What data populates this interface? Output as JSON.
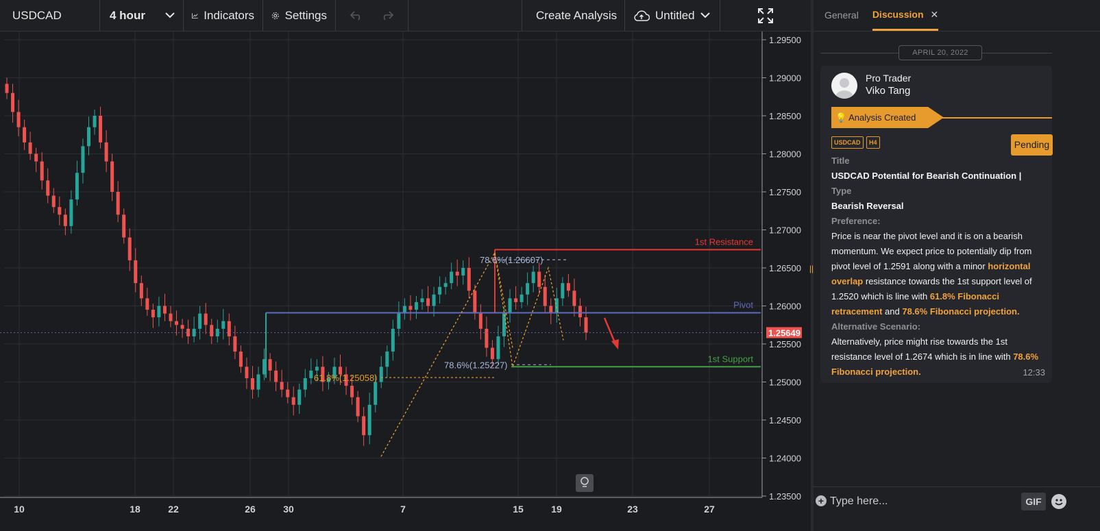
{
  "toolbar": {
    "symbol": "USDCAD",
    "interval": "4 hour",
    "indicators": "Indicators",
    "settings": "Settings",
    "create_analysis": "Create Analysis",
    "layout_name": "Untitled"
  },
  "chart": {
    "price_ticks": [
      "1.29500",
      "1.29000",
      "1.28500",
      "1.28000",
      "1.27500",
      "1.27000",
      "1.26500",
      "1.26000",
      "1.25500",
      "1.25000",
      "1.24500",
      "1.24000",
      "1.23500"
    ],
    "date_ticks": [
      "10",
      "18",
      "22",
      "26",
      "30",
      "7",
      "15",
      "19",
      "23",
      "27"
    ],
    "current_price": "1.25649",
    "levels": {
      "resistance": "1st Resistance",
      "pivot": "Pivot",
      "support": "1st Support"
    },
    "fib_labels": {
      "fib_top": "78.6%(1.26607)",
      "fib_mid": "78.6%(1.25227)",
      "fib_left": "61.8%(1.25058)"
    },
    "colors": {
      "bull": "#26a69a",
      "bear": "#ef5350",
      "resistance": "#e53935",
      "pivot": "#5c6bc0",
      "support": "#43a047",
      "fib": "#e69b2c",
      "price_tag": "#ef5350"
    }
  },
  "chart_data": {
    "type": "candlestick",
    "symbol": "USDCAD",
    "timeframe": "H4",
    "ylim": [
      1.235,
      1.295
    ],
    "current_price": 1.25649,
    "levels": [
      {
        "name": "1st Resistance",
        "value": 1.2674
      },
      {
        "name": "Pivot",
        "value": 1.2591
      },
      {
        "name": "1st Support",
        "value": 1.252
      }
    ],
    "fibonacci": [
      {
        "label": "78.6%",
        "value": 1.26607
      },
      {
        "label": "78.6%",
        "value": 1.25227
      },
      {
        "label": "61.8%",
        "value": 1.25058
      }
    ],
    "close_path": [
      1.288,
      1.2855,
      1.2835,
      1.2815,
      1.28,
      1.279,
      1.2765,
      1.2745,
      1.273,
      1.272,
      1.2705,
      1.274,
      1.2775,
      1.281,
      1.2835,
      1.285,
      1.2815,
      1.279,
      1.275,
      1.272,
      1.269,
      1.266,
      1.263,
      1.261,
      1.2595,
      1.2585,
      1.26,
      1.259,
      1.258,
      1.2575,
      1.257,
      1.256,
      1.257,
      1.259,
      1.2575,
      1.256,
      1.257,
      1.258,
      1.256,
      1.254,
      1.252,
      1.2505,
      1.249,
      1.251,
      1.253,
      1.2515,
      1.25,
      1.249,
      1.248,
      1.247,
      1.249,
      1.2505,
      1.2515,
      1.252,
      1.25,
      1.2505,
      1.252,
      1.251,
      1.2495,
      1.248,
      1.2455,
      1.243,
      1.247,
      1.25,
      1.252,
      1.254,
      1.257,
      1.259,
      1.26,
      1.2595,
      1.2605,
      1.261,
      1.26,
      1.2615,
      1.2625,
      1.263,
      1.2645,
      1.264,
      1.265,
      1.262,
      1.259,
      1.257,
      1.2545,
      1.253,
      1.256,
      1.259,
      1.261,
      1.2605,
      1.2615,
      1.263,
      1.2645,
      1.2625,
      1.26,
      1.259,
      1.261,
      1.263,
      1.262,
      1.26,
      1.2585,
      1.2565
    ]
  },
  "panel": {
    "tabs": [
      "General",
      "Discussion"
    ],
    "date": "APRIL 20, 2022",
    "user_role": "Pro Trader",
    "user_name": "Viko Tang",
    "badge": "Analysis Created",
    "tag_symbol": "USDCAD",
    "tag_tf": "H4",
    "status": "Pending",
    "title_label": "Title",
    "title": "USDCAD Potential for Bearish Continuation |",
    "type_label": "Type",
    "type": "Bearish Reversal",
    "pref_label": "Preference:",
    "pref_1": "Price is near the pivot level and it is on a bearish momentum. We expect price to potentially dip from pivot level of 1.2591 along with a minor ",
    "pref_hl_1": "horizontal overlap",
    "pref_2": " resistance towards the 1st support level of 1.2520 which is line with ",
    "pref_hl_2": "61.8% Fibonacci retracement",
    "pref_3": " and ",
    "pref_hl_3": "78.6% Fibonacci projection.",
    "alt_label": "Alternative Scenario:",
    "alt_1": "Alternatively, price might rise towards the 1st resistance level of 1.2674 which is in line with ",
    "alt_hl_1": "78.6% Fibonacci projection.",
    "time": "12:33",
    "composer_placeholder": "Type here...",
    "gif": "GIF"
  }
}
